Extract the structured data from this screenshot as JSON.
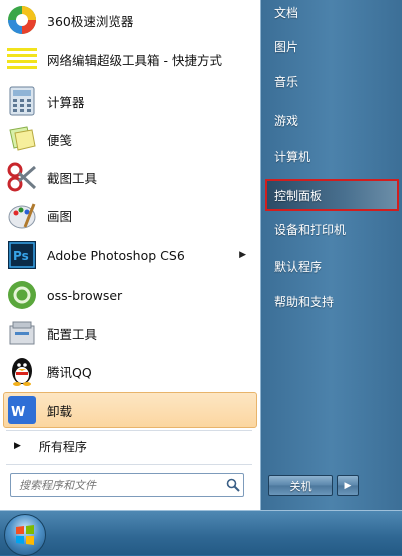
{
  "programs": [
    {
      "label": "360极速浏览器",
      "icon": "browser-360-icon"
    },
    {
      "label": "网络编辑超级工具箱 - 快捷方式",
      "icon": "toolbox-shortcut-icon"
    },
    {
      "label": "计算器",
      "icon": "calculator-icon"
    },
    {
      "label": "便笺",
      "icon": "sticky-notes-icon"
    },
    {
      "label": "截图工具",
      "icon": "snipping-tool-icon"
    },
    {
      "label": "画图",
      "icon": "paint-icon"
    },
    {
      "label": "Adobe Photoshop CS6",
      "icon": "photoshop-icon"
    },
    {
      "label": "oss-browser",
      "icon": "oss-browser-icon"
    },
    {
      "label": "配置工具",
      "icon": "config-tool-icon"
    },
    {
      "label": "腾讯QQ",
      "icon": "qq-penguin-icon"
    },
    {
      "label": "卸载",
      "icon": "wps-uninstall-icon"
    }
  ],
  "all_programs": "所有程序",
  "search": {
    "placeholder": "搜索程序和文件"
  },
  "right_links": [
    "文档",
    "图片",
    "音乐",
    "游戏",
    "计算机",
    "控制面板",
    "设备和打印机",
    "默认程序",
    "帮助和支持"
  ],
  "shutdown_label": "关机",
  "colors": {
    "selection_border": "#d21e1e",
    "highlight_fill": "#fbd6a0",
    "right_pane": "#4c82ab"
  }
}
